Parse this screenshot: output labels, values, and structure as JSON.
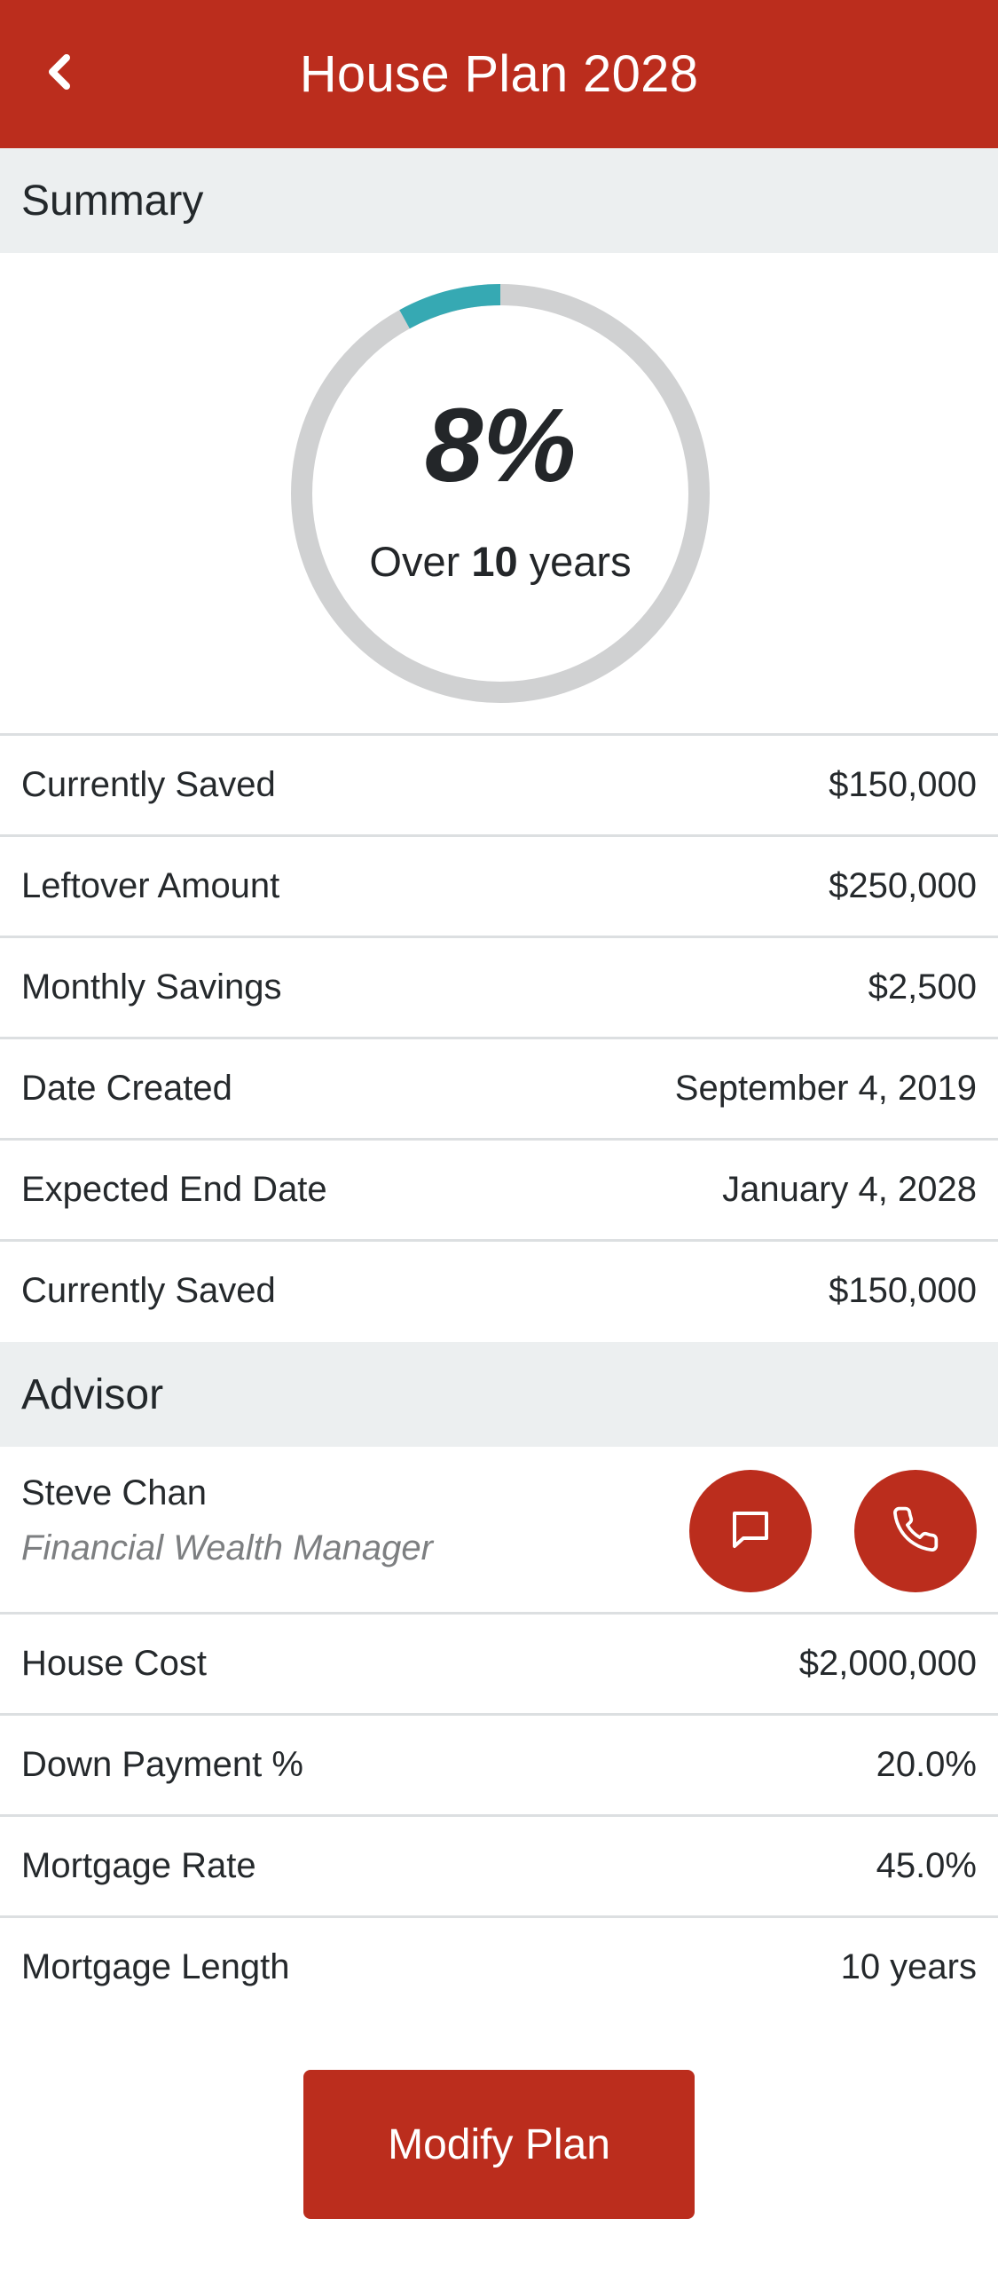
{
  "header": {
    "title": "House Plan 2028",
    "back_icon": "chevron-left-icon",
    "background": "#bb2d1d"
  },
  "summary": {
    "section_label": "Summary",
    "progress": {
      "percent_label": "8%",
      "percent_value": 8,
      "sub_prefix": "Over ",
      "sub_number": "10",
      "sub_suffix": " years",
      "track_color": "#d0d1d2",
      "fill_color": "#36a9b3"
    },
    "rows": [
      {
        "label": "Currently Saved",
        "value": "$150,000"
      },
      {
        "label": "Leftover Amount",
        "value": "$250,000"
      },
      {
        "label": "Monthly Savings",
        "value": "$2,500"
      },
      {
        "label": "Date Created",
        "value": "September 4, 2019"
      },
      {
        "label": "Expected End Date",
        "value": "January 4, 2028"
      },
      {
        "label": "Currently Saved",
        "value": "$150,000"
      }
    ]
  },
  "advisor": {
    "section_label": "Advisor",
    "name": "Steve Chan",
    "role": "Financial Wealth Manager",
    "message_icon": "chat-bubble-icon",
    "call_icon": "phone-icon",
    "rows": [
      {
        "label": "House Cost",
        "value": "$2,000,000"
      },
      {
        "label": "Down Payment %",
        "value": "20.0%"
      },
      {
        "label": "Mortgage Rate",
        "value": "45.0%"
      },
      {
        "label": "Mortgage Length",
        "value": "10 years"
      }
    ]
  },
  "actions": {
    "modify_label": "Modify Plan"
  }
}
